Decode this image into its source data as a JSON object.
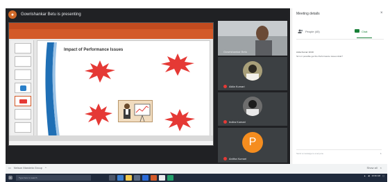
{
  "meet": {
    "presenting_text": "Gowrishankar Betu is presenting"
  },
  "panel": {
    "title": "Meeting details",
    "close_icon": "close-icon",
    "tabs": [
      {
        "label": "People (45)",
        "icon": "people-icon"
      },
      {
        "label": "Chat",
        "icon": "chat-icon",
        "active": true
      }
    ],
    "message_author": "Anita Kumar 10:20",
    "message_text": "Sir is it possible get the Performance issues slide?",
    "input_placeholder": "Send a message to everyone"
  },
  "participants": [
    {
      "name": "Gowrishankar Betu",
      "type": "video"
    },
    {
      "name": "Akila Kumari",
      "type": "avatar"
    },
    {
      "name": "Indira Kumari",
      "type": "avatar"
    },
    {
      "name": "Anitha Kumari",
      "type": "letter",
      "letter": "P"
    }
  ],
  "slide": {
    "title": "Impact of Performance Issues"
  },
  "browser": {
    "tab_label": "Nelson Mandela Group",
    "close": "×",
    "right_label": "Show all"
  },
  "taskbar": {
    "search_placeholder": "Type here to search",
    "time": "10:30 AM"
  },
  "colors": {
    "meet_dark": "#202124",
    "ppt_orange": "#d35a29",
    "burst_red": "#e53935",
    "panel_green": "#188038",
    "avatar_orange": "#f58d1f"
  }
}
